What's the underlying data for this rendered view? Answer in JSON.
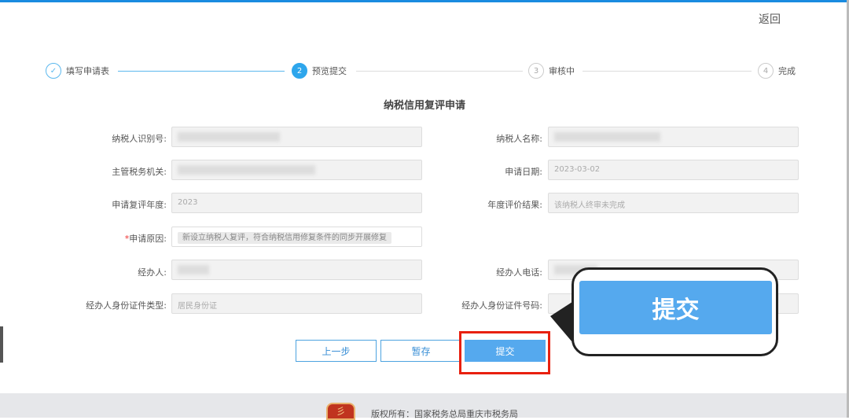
{
  "header": {
    "back_label": "返回"
  },
  "steps": [
    {
      "num": "✓",
      "label": "填写申请表",
      "state": "done"
    },
    {
      "num": "2",
      "label": "预览提交",
      "state": "active"
    },
    {
      "num": "3",
      "label": "审核中",
      "state": "pending"
    },
    {
      "num": "4",
      "label": "完成",
      "state": "pending"
    }
  ],
  "form": {
    "title": "纳税信用复评申请",
    "taxpayer_id_label": "纳税人识别号:",
    "taxpayer_name_label": "纳税人名称:",
    "tax_authority_label": "主管税务机关:",
    "apply_date_label": "申请日期:",
    "apply_date": "2023-03-02",
    "review_year_label": "申请复评年度:",
    "review_year": "2023",
    "result_label": "年度评价结果:",
    "result": "该纳税人终审未完成",
    "reason_required": "*",
    "reason_label": "申请原因:",
    "reason": "新设立纳税人复评，符合纳税信用修复条件的同步开展修复",
    "agent_label": "经办人:",
    "agent_phone_label": "经办人电话:",
    "id_type_label": "经办人身份证件类型:",
    "id_type": "居民身份证",
    "id_number_label": "经办人身份证件号码:"
  },
  "buttons": {
    "prev": "上一步",
    "save": "暂存",
    "submit": "提交"
  },
  "callout": {
    "label": "提交"
  },
  "footer": {
    "copyright": "版权所有：国家税务总局重庆市税务局"
  },
  "colors": {
    "accent": "#2ea6ec",
    "highlight": "#e8200f"
  }
}
